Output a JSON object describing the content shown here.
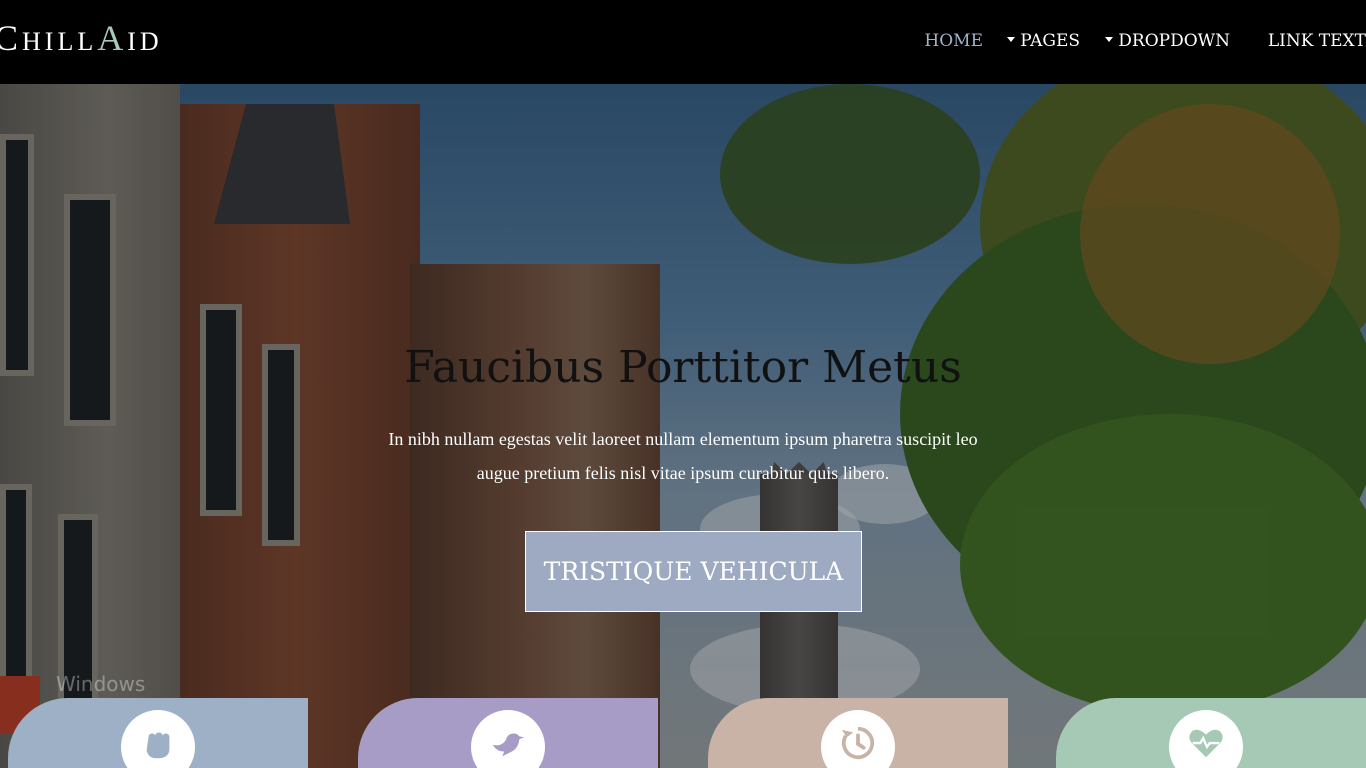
{
  "brand": {
    "logo_first_letter": "C",
    "logo_middle": "HILL",
    "logo_accent_letter": "A",
    "logo_end": "ID",
    "accent_color": "#a8c8b8"
  },
  "nav": {
    "home": "HOME",
    "pages": "PAGES",
    "dropdown": "DROPDOWN",
    "link_text": "LINK TEXT",
    "active_color": "#9fb3cc"
  },
  "hero": {
    "title": "Faucibus Porttitor Metus",
    "text": "In nibh nullam egestas velit laoreet nullam elementum ipsum pharetra suscipit leo augue pretium felis nisl vitae ipsum curabitur quis libero.",
    "cta_label": "TRISTIQUE VEHICULA",
    "cta_color": "#9daac2"
  },
  "watermark": {
    "line1": "Windows",
    "line2": "..."
  },
  "cards": [
    {
      "icon": "hand-fist-icon",
      "color": "#9eb0c6"
    },
    {
      "icon": "dove-icon",
      "color": "#a79cc6"
    },
    {
      "icon": "history-icon",
      "color": "#c9b3a6"
    },
    {
      "icon": "heartbeat-icon",
      "color": "#a6c9b6"
    }
  ]
}
